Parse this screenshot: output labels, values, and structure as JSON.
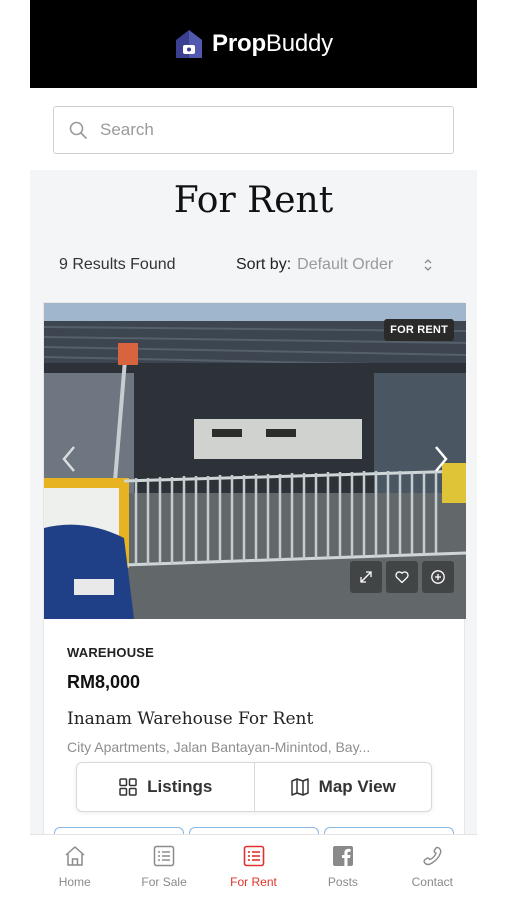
{
  "header": {
    "logo_bold": "Prop",
    "logo_light": "Buddy"
  },
  "search": {
    "placeholder": "Search",
    "value": ""
  },
  "page": {
    "title": "For Rent",
    "results_text": "9 Results Found",
    "sort_label": "Sort by:",
    "sort_value": "Default Order"
  },
  "listing": {
    "badge": "FOR RENT",
    "type": "WAREHOUSE",
    "price": "RM8,000",
    "title": "Inanam Warehouse For Rent",
    "address": "City Apartments, Jalan Bantayan-Minintod, Bay..."
  },
  "view_toggle": {
    "listings_label": "Listings",
    "map_label": "Map View"
  },
  "tabbar": {
    "items": [
      {
        "label": "Home",
        "icon": "home-icon"
      },
      {
        "label": "For Sale",
        "icon": "list-icon"
      },
      {
        "label": "For Rent",
        "icon": "list-icon",
        "active": true
      },
      {
        "label": "Posts",
        "icon": "facebook-icon"
      },
      {
        "label": "Contact",
        "icon": "phone-icon"
      }
    ]
  },
  "colors": {
    "accent": "#e0322c",
    "header_bg": "#000000",
    "logo_icon": "#3b3f8f"
  }
}
